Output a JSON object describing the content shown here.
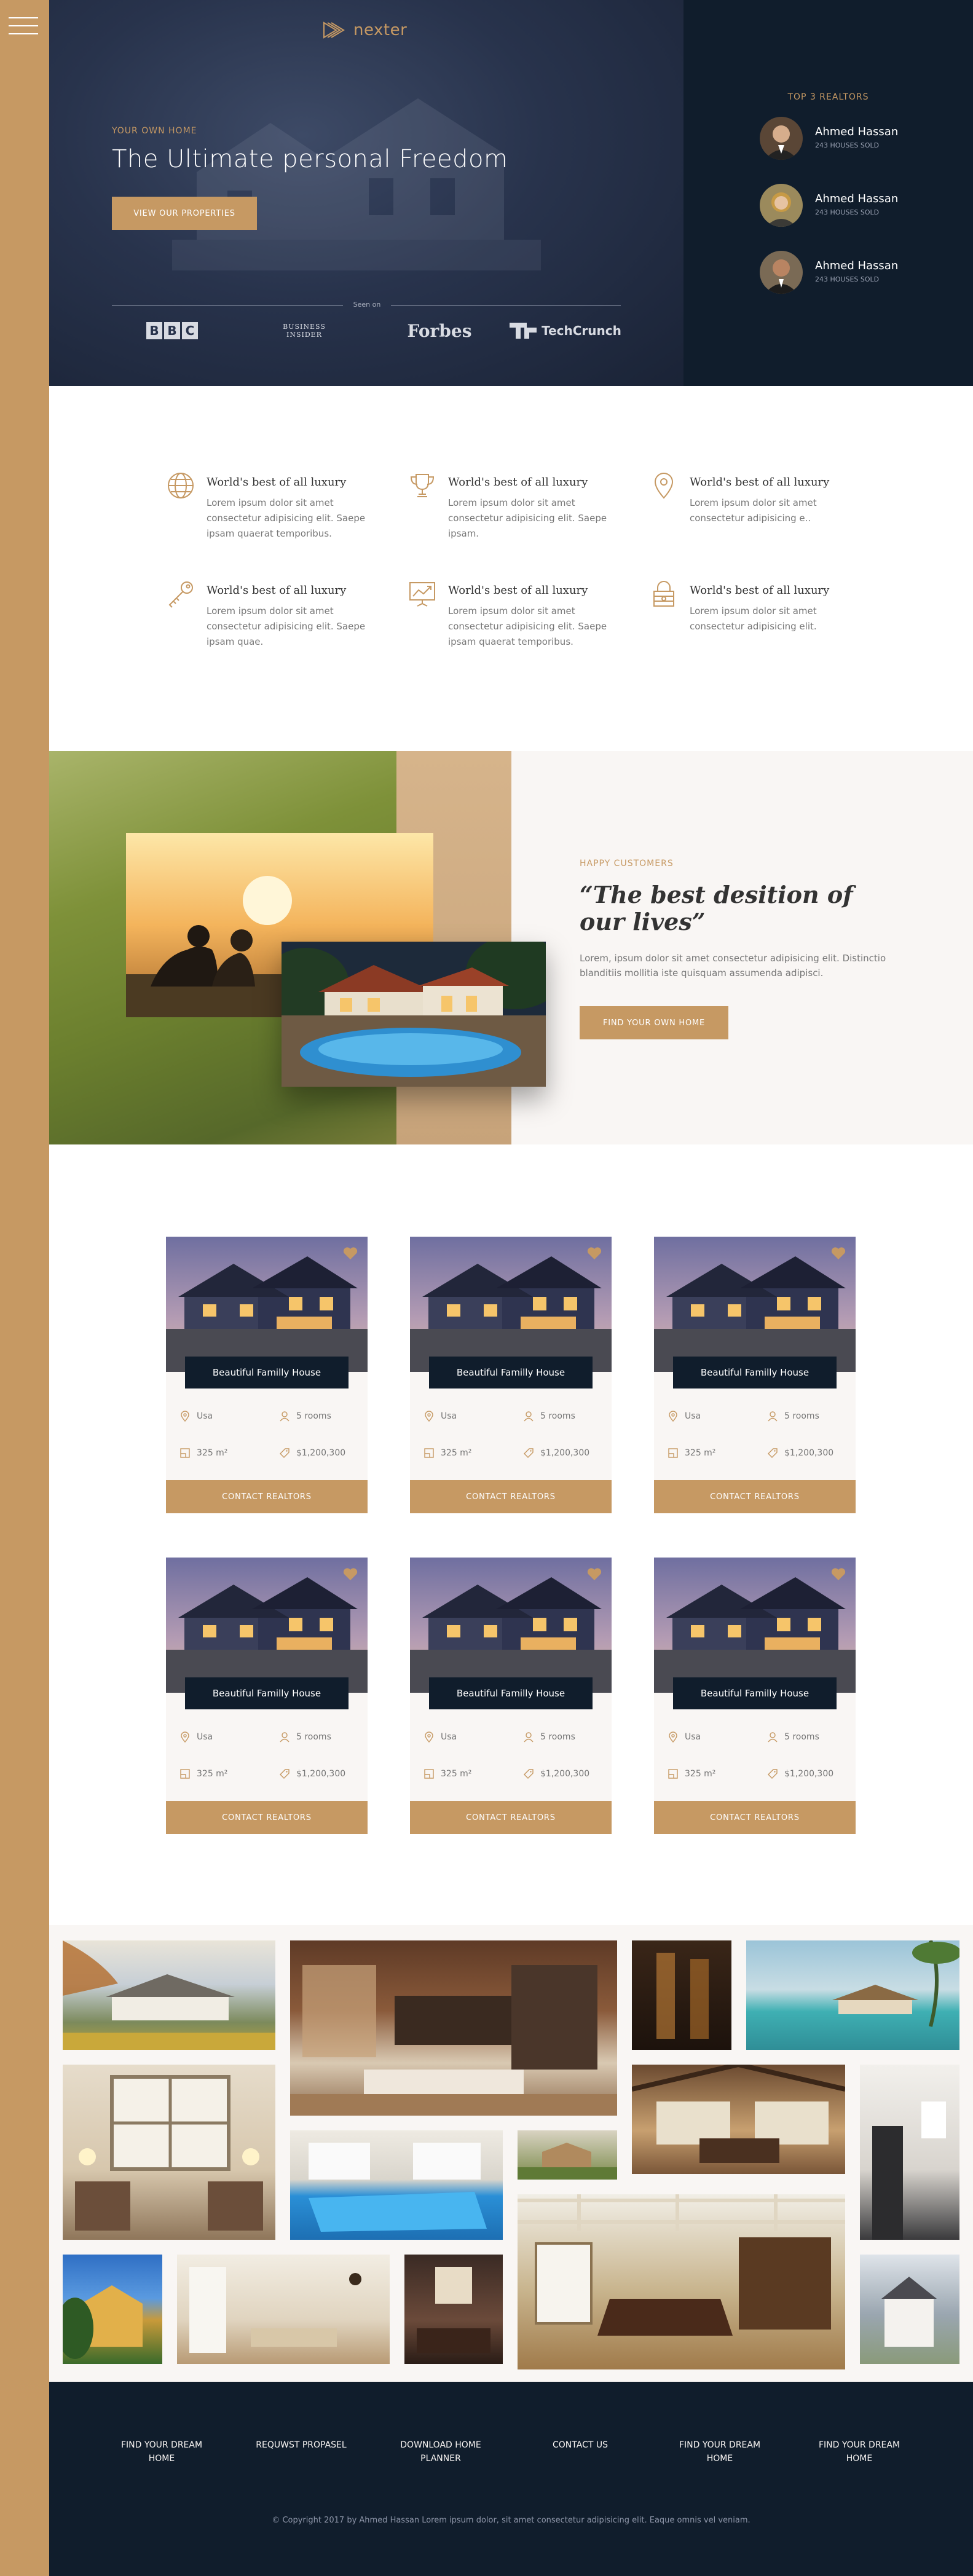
{
  "brand": {
    "name": "nexter",
    "gold": "#c69963",
    "navy": "#101d2c",
    "cream": "#f9f6f4"
  },
  "hero": {
    "subtitle": "Your own home",
    "title": "The Ultimate personal Freedom",
    "cta": "View our properties",
    "seen_on": "Seen on",
    "press": [
      "BBC",
      "BUSINESS INSIDER",
      "Forbes",
      "TechCrunch"
    ]
  },
  "realtors": {
    "title": "Top 3 Realtors",
    "list": [
      {
        "name": "Ahmed Hassan",
        "sold": "243 houses sold"
      },
      {
        "name": "Ahmed Hassan",
        "sold": "243 houses sold"
      },
      {
        "name": "Ahmed Hassan",
        "sold": "243 houses sold"
      }
    ]
  },
  "features": [
    {
      "icon": "globe-icon",
      "title": "World's best of all luxury",
      "text": "Lorem ipsum dolor sit amet consectetur adipisicing elit. Saepe ipsam quaerat temporibus."
    },
    {
      "icon": "trophy-icon",
      "title": "World's best of all luxury",
      "text": "Lorem ipsum dolor sit amet consectetur adipisicing elit. Saepe ipsam."
    },
    {
      "icon": "map-pin-icon",
      "title": "World's best of all luxury",
      "text": "Lorem ipsum dolor sit amet consectetur adipisicing e.."
    },
    {
      "icon": "key-icon",
      "title": "World's best of all luxury",
      "text": "Lorem ipsum dolor sit amet consectetur adipisicing elit. Saepe ipsam quae."
    },
    {
      "icon": "chart-icon",
      "title": "World's best of all luxury",
      "text": "Lorem ipsum dolor sit amet consectetur adipisicing elit. Saepe ipsam quaerat temporibus."
    },
    {
      "icon": "lock-icon",
      "title": "World's best of all luxury",
      "text": "Lorem ipsum dolor sit amet consectetur adipisicing elit."
    }
  ],
  "story": {
    "subtitle": "Happy Customers",
    "title": "“The best desition of our lives”",
    "text": "Lorem, ipsum dolor sit amet consectetur adipisicing elit. Distinctio blanditiis mollitia iste quisquam assumenda adipisci.",
    "cta": "Find your own home"
  },
  "homes": [
    {
      "name": "Beautiful Familly House",
      "location": "Usa",
      "rooms": "5 rooms",
      "area": "325 m²",
      "price": "$1,200,300",
      "cta": "Contact realtors"
    },
    {
      "name": "Beautiful Familly House",
      "location": "Usa",
      "rooms": "5 rooms",
      "area": "325 m²",
      "price": "$1,200,300",
      "cta": "Contact realtors"
    },
    {
      "name": "Beautiful Familly House",
      "location": "Usa",
      "rooms": "5 rooms",
      "area": "325 m²",
      "price": "$1,200,300",
      "cta": "Contact realtors"
    },
    {
      "name": "Beautiful Familly House",
      "location": "Usa",
      "rooms": "5 rooms",
      "area": "325 m²",
      "price": "$1,200,300",
      "cta": "Contact realtors"
    },
    {
      "name": "Beautiful Familly House",
      "location": "Usa",
      "rooms": "5 rooms",
      "area": "325 m²",
      "price": "$1,200,300",
      "cta": "Contact realtors"
    },
    {
      "name": "Beautiful Familly House",
      "location": "Usa",
      "rooms": "5 rooms",
      "area": "325 m²",
      "price": "$1,200,300",
      "cta": "Contact realtors"
    }
  ],
  "footer": {
    "links": [
      "Find your dream home",
      "Requwst propasel",
      "Download home planner",
      "Contact us",
      "Find your dream home",
      "Find your dream home"
    ],
    "copyright": "© Copyright 2017 by Ahmed Hassan Lorem ipsum dolor, sit amet consectetur adipisicing elit. Eaque omnis vel veniam."
  }
}
